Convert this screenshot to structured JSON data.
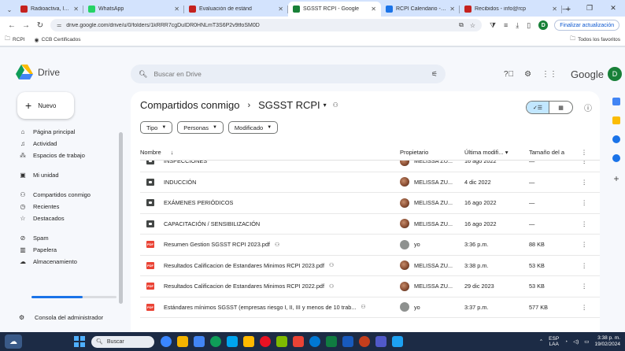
{
  "browser": {
    "tabs": [
      {
        "label": "Radioactiva, la e",
        "active": false,
        "color": "#c5221f"
      },
      {
        "label": "WhatsApp",
        "active": false,
        "color": "#25d366"
      },
      {
        "label": "Evaluación de estánd",
        "active": false,
        "color": "#c5221f"
      },
      {
        "label": "SGSST RCPI - Google",
        "active": true,
        "color": "#188038"
      },
      {
        "label": "RCPI Calendario - en",
        "active": false,
        "color": "#1a73e8"
      },
      {
        "label": "Recibidos - info@rcp",
        "active": false,
        "color": "#c5221f"
      }
    ],
    "url": "drive.google.com/drive/u/0/folders/1kRRR7cgDuIDR0HNLmT3S6P2v9tfoSM0D",
    "account_initial": "D",
    "update_button": "Finalizar actualización",
    "bookmarks": [
      {
        "label": "RCPI"
      },
      {
        "label": "CCB Certificados"
      }
    ],
    "bookmarks_right": "Todos los favoritos"
  },
  "drive": {
    "brand": "Drive",
    "search_placeholder": "Buscar en Drive",
    "brand_right": "Google",
    "avatar_initial": "D",
    "new_button": "Nuevo",
    "nav": [
      {
        "label": "Página principal",
        "icon": "⌂",
        "name": "home"
      },
      {
        "label": "Actividad",
        "icon": "♫",
        "name": "activity"
      },
      {
        "label": "Espacios de trabajo",
        "icon": "⁂",
        "name": "workspaces"
      },
      {
        "label": "Mi unidad",
        "icon": "▣",
        "name": "my-drive"
      },
      {
        "label": "Compartidos conmigo",
        "icon": "⚇",
        "name": "shared"
      },
      {
        "label": "Recientes",
        "icon": "◷",
        "name": "recent"
      },
      {
        "label": "Destacados",
        "icon": "☆",
        "name": "starred"
      },
      {
        "label": "Spam",
        "icon": "⊘",
        "name": "spam"
      },
      {
        "label": "Papelera",
        "icon": "▥",
        "name": "trash"
      },
      {
        "label": "Almacenamiento",
        "icon": "☁",
        "name": "storage"
      }
    ],
    "admin_console": "Consola del administrador",
    "breadcrumb": {
      "root": "Compartidos conmigo",
      "current": "SGSST RCPI"
    },
    "filters": [
      "Tipo",
      "Personas",
      "Modificado"
    ],
    "columns": {
      "name": "Nombre",
      "owner": "Propietario",
      "modified": "Última modifi...",
      "size": "Tamaño del a"
    },
    "files": [
      {
        "type": "folder",
        "name": "INSPECCIONES",
        "owner": "MELISSA ZU...",
        "owner_avatar": "photo",
        "modified": "16 ago 2022",
        "size": "—",
        "shared": false
      },
      {
        "type": "folder",
        "name": "INDUCCIÓN",
        "owner": "MELISSA ZU...",
        "owner_avatar": "photo",
        "modified": "4 dic 2022",
        "size": "—",
        "shared": false
      },
      {
        "type": "folder",
        "name": "EXÁMENES PERIÓDICOS",
        "owner": "MELISSA ZU...",
        "owner_avatar": "photo",
        "modified": "16 ago 2022",
        "size": "—",
        "shared": false
      },
      {
        "type": "folder",
        "name": "CAPACITACIÓN / SENSIBILIZACIÓN",
        "owner": "MELISSA ZU...",
        "owner_avatar": "photo",
        "modified": "16 ago 2022",
        "size": "—",
        "shared": false
      },
      {
        "type": "pdf",
        "name": "Resumen Gestion SGSST RCPI 2023.pdf",
        "owner": "yo",
        "owner_avatar": "generic",
        "modified": "3:36 p.m.",
        "size": "88 KB",
        "shared": true
      },
      {
        "type": "pdf",
        "name": "Resultados Calificacion de Estandares Minimos RCPI 2023.pdf",
        "owner": "MELISSA ZU...",
        "owner_avatar": "photo",
        "modified": "3:38 p.m.",
        "size": "53 KB",
        "shared": true
      },
      {
        "type": "pdf",
        "name": "Resultados Calificacion de Estandares Minimos RCPI 2022.pdf",
        "owner": "MELISSA ZU...",
        "owner_avatar": "photo",
        "modified": "29 dic 2023",
        "size": "53 KB",
        "shared": true
      },
      {
        "type": "pdf",
        "name": "Estándares mínimos SGSST (empresas riesgo I, II, III y menos de 10 trab...",
        "owner": "yo",
        "owner_avatar": "generic",
        "modified": "3:37 p.m.",
        "size": "577 KB",
        "shared": true
      }
    ]
  },
  "taskbar": {
    "search": "Buscar",
    "lang_top": "ESP",
    "lang_bottom": "LAA",
    "time": "3:38 p. m.",
    "date": "19/02/2024",
    "apps": [
      "#3a86ff",
      "#f4b400",
      "#4285f4",
      "#0f9d58",
      "#00a4ef",
      "#ffb900",
      "#e81123",
      "#7fba00",
      "#ea4335",
      "#0078d4",
      "#107c41",
      "#185abd",
      "#c43e1c",
      "#5059c9",
      "#1da1f2"
    ]
  }
}
